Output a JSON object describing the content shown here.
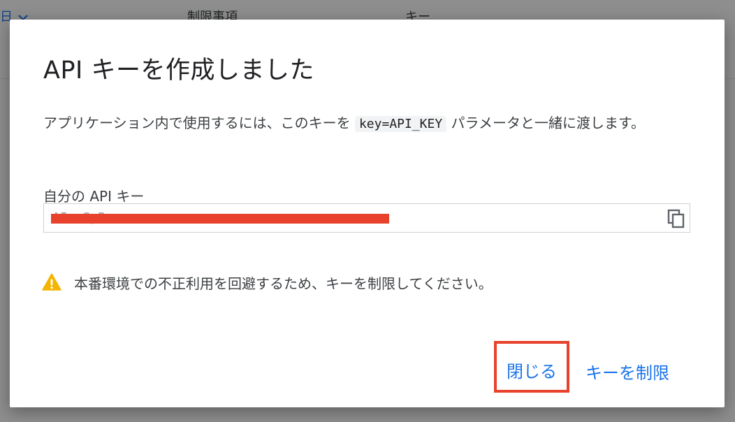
{
  "background": {
    "date_header": "日",
    "column_restrictions": "制限事項",
    "column_key": "キー"
  },
  "dialog": {
    "title": "API キーを作成しました",
    "description_before": "アプリケーション内で使用するには、このキーを",
    "description_code": "key=API_KEY",
    "description_after": "パラメータと一緒に渡します。",
    "key_label": "自分の API キー",
    "key_value": "AIzaSyB-xxxxxxxxxxxxxxxxxxxxxxxxxxxxxxxx",
    "warning": "本番環境での不正利用を回避するため、キーを制限してください。",
    "close_button": "閉じる",
    "restrict_button": "キーを制限"
  },
  "colors": {
    "accent": "#1a73e8",
    "warning": "#f4b400",
    "highlight": "#e8412c"
  },
  "icons": {
    "copy": "copy-icon",
    "warning": "warning-icon",
    "chevron": "chevron-down-icon"
  }
}
